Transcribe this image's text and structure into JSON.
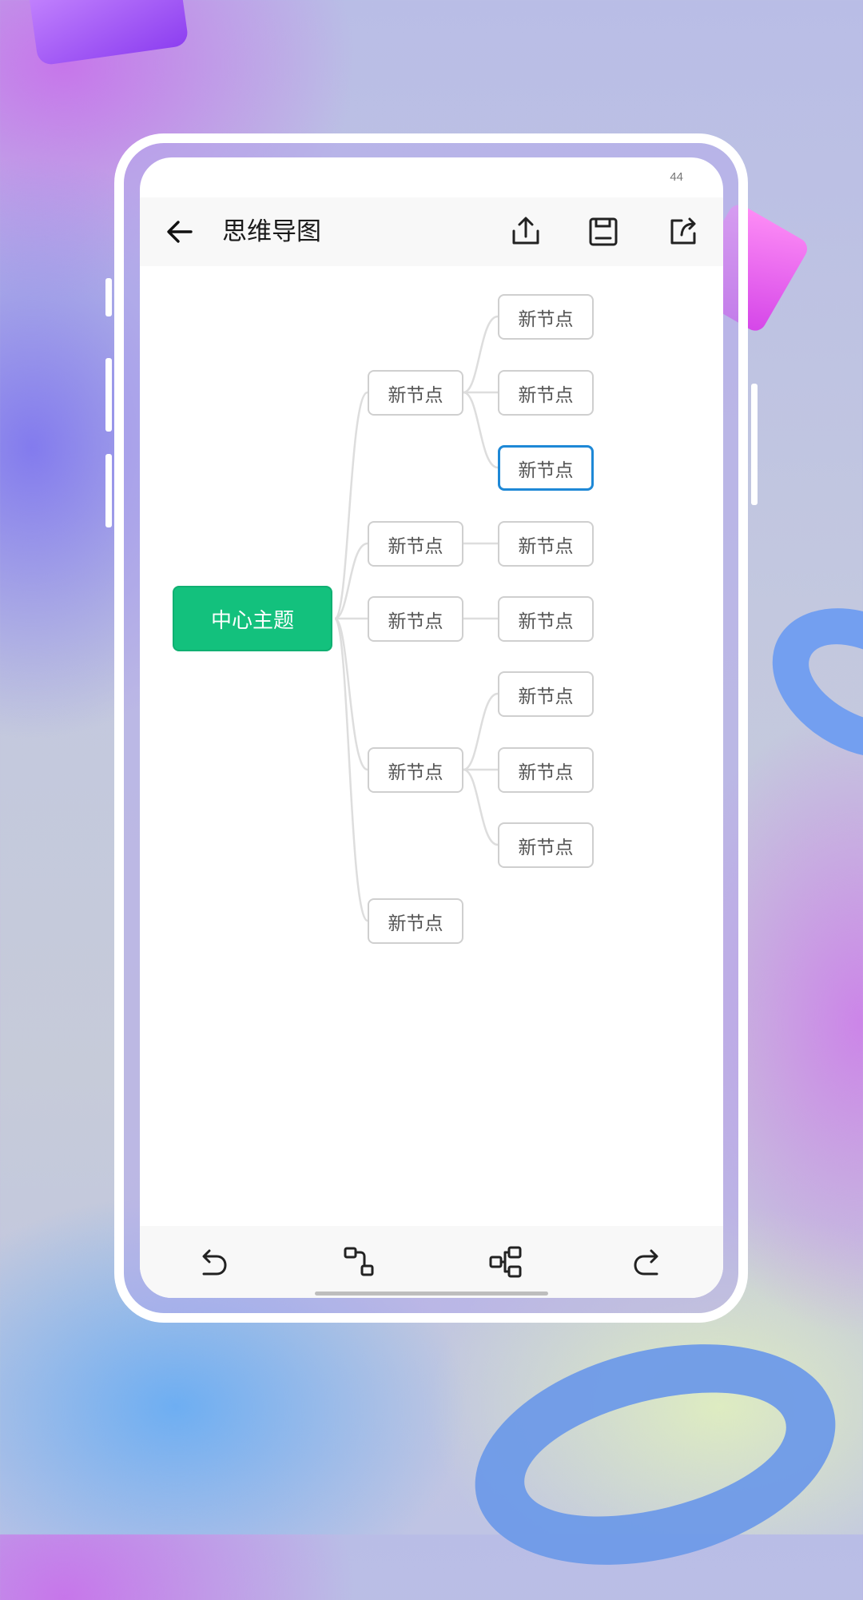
{
  "status": {
    "text": "44"
  },
  "app_bar": {
    "title": "思维导图",
    "icons": [
      "back-arrow-icon",
      "share-upload-icon",
      "save-icon",
      "export-icon"
    ]
  },
  "mindmap": {
    "root": "中心主题",
    "level1": [
      "新节点",
      "新节点",
      "新节点",
      "新节点",
      "新节点"
    ],
    "level2": [
      "新节点",
      "新节点",
      "新节点",
      "新节点",
      "新节点",
      "新节点",
      "新节点",
      "新节点"
    ],
    "selected_node": "level2 index 2"
  },
  "bottom_bar": {
    "icons": [
      "undo-icon",
      "add-child-node-icon",
      "add-sibling-node-icon",
      "redo-icon"
    ]
  },
  "colors": {
    "root_fill": "#13c17d",
    "selected_border": "#1e88d6",
    "node_border": "#cfcfcf",
    "connector": "#dddddd"
  }
}
